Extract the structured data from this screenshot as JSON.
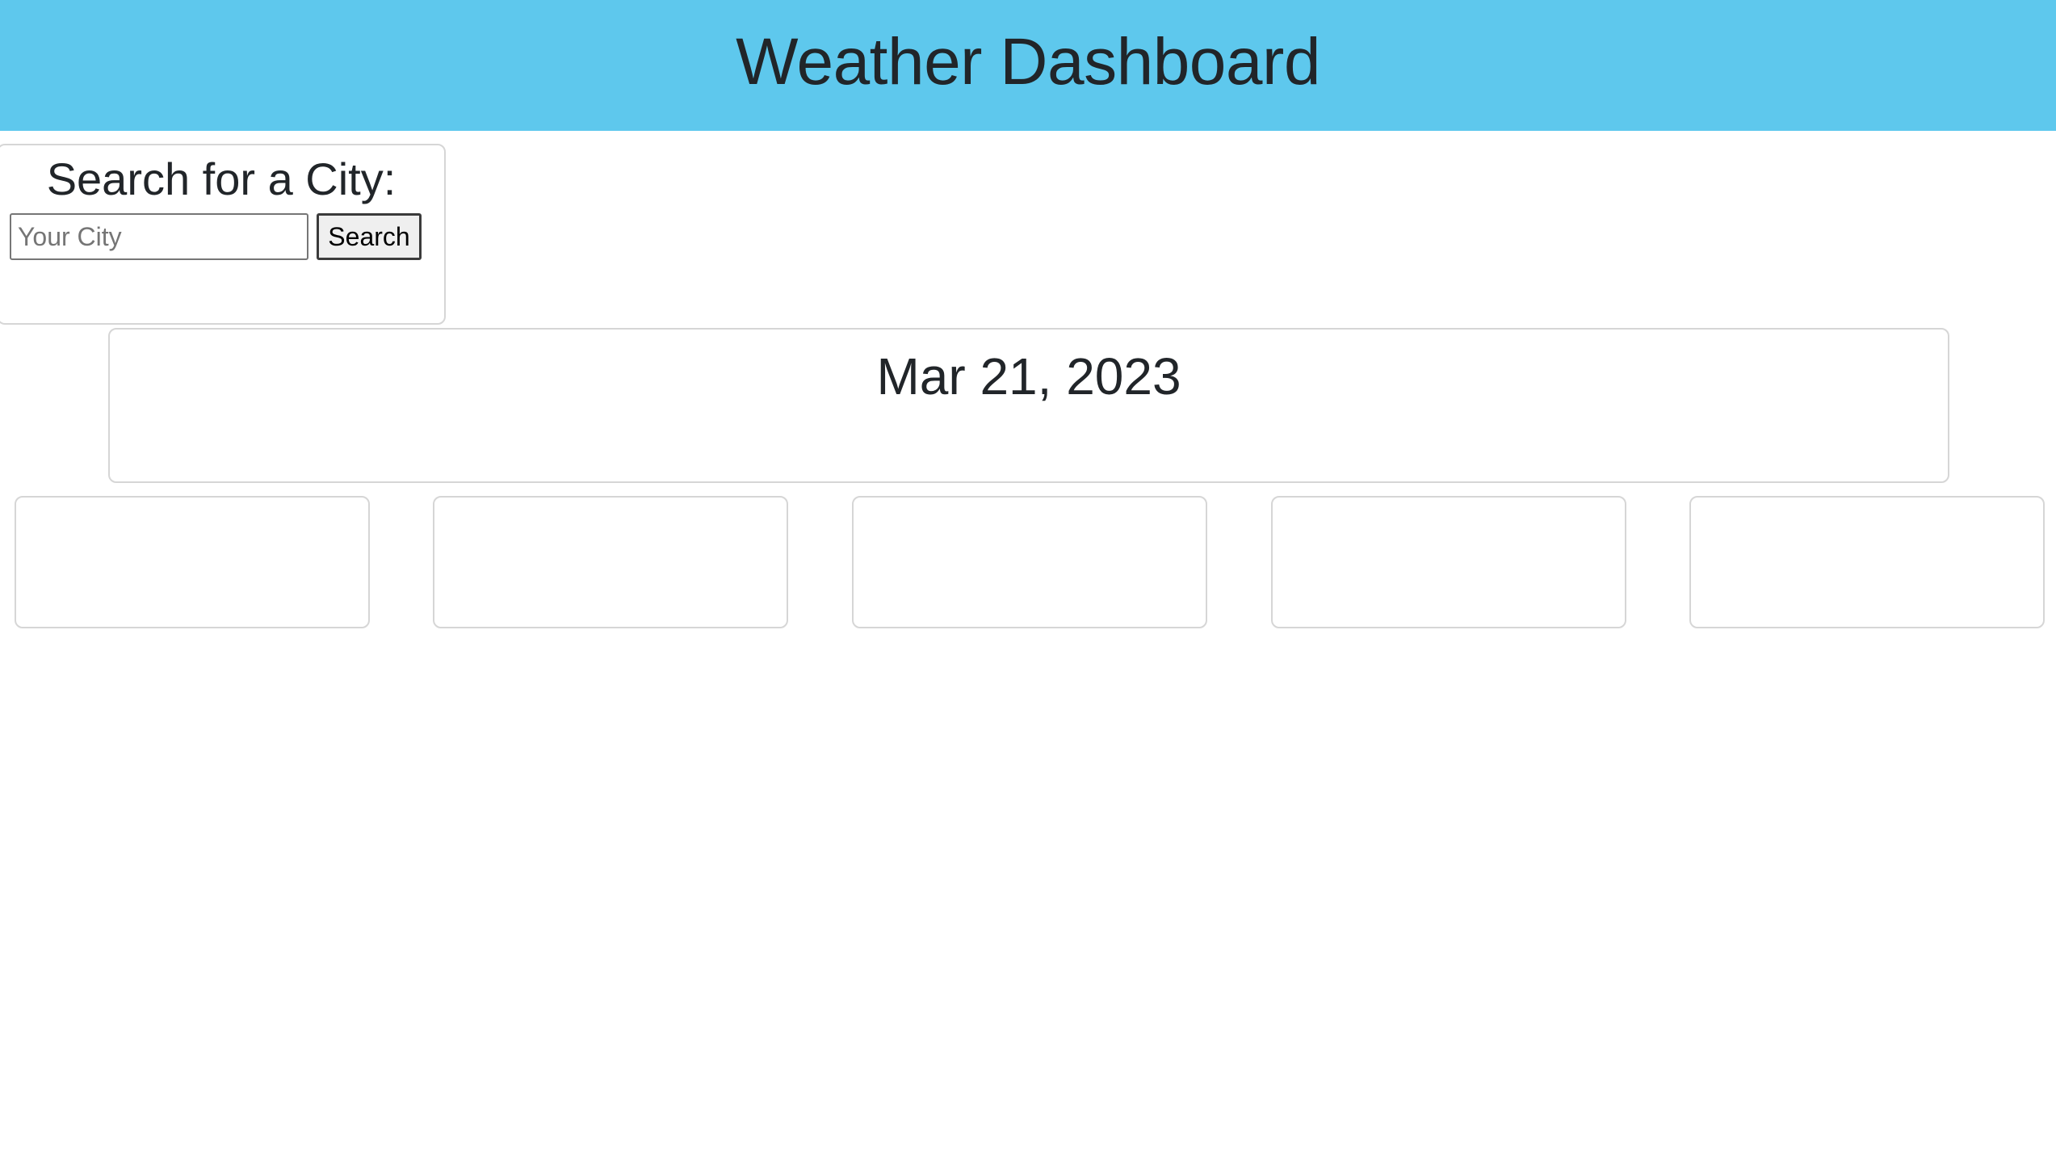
{
  "header": {
    "title": "Weather Dashboard",
    "background_color": "#5ec8ed"
  },
  "search": {
    "heading": "Search for a City:",
    "input_value": "",
    "input_placeholder": "Your City",
    "button_label": "Search"
  },
  "current": {
    "date": "Mar 21, 2023"
  },
  "forecast": {
    "cards": [
      {
        "text": ""
      },
      {
        "text": ""
      },
      {
        "text": ""
      },
      {
        "text": ""
      },
      {
        "text": ""
      }
    ]
  },
  "colors": {
    "text": "#212529",
    "card_border": "#d6d6d6"
  }
}
